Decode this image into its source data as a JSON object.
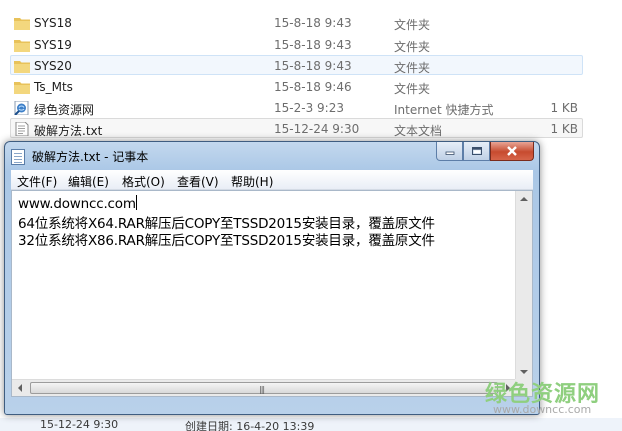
{
  "explorer": {
    "files": [
      {
        "name": "SYS18",
        "date": "15-8-18 9:43",
        "type": "文件夹",
        "size": "",
        "icon": "folder-icon",
        "state": ""
      },
      {
        "name": "SYS19",
        "date": "15-8-18 9:43",
        "type": "文件夹",
        "size": "",
        "icon": "folder-icon",
        "state": ""
      },
      {
        "name": "SYS20",
        "date": "15-8-18 9:43",
        "type": "文件夹",
        "size": "",
        "icon": "folder-icon",
        "state": "selected"
      },
      {
        "name": "Ts_Mts",
        "date": "15-8-18 9:46",
        "type": "文件夹",
        "size": "",
        "icon": "folder-icon",
        "state": ""
      },
      {
        "name": "绿色资源网",
        "date": "15-2-3 9:23",
        "type": "Internet 快捷方式",
        "size": "1 KB",
        "icon": "internet-shortcut-icon",
        "state": ""
      },
      {
        "name": "破解方法.txt",
        "date": "15-12-24 9:30",
        "type": "文本文档",
        "size": "1 KB",
        "icon": "text-file-icon",
        "state": "hover"
      }
    ],
    "status_left": "15-12-24 9:30",
    "status_mid": "创建日期: 16-4-20 13:39"
  },
  "notepad": {
    "title": "破解方法.txt - 记事本",
    "menu": [
      "文件(F)",
      "编辑(E)",
      "格式(O)",
      "查看(V)",
      "帮助(H)"
    ],
    "lines": [
      "www.downcc.com",
      "64位系统将X64.RAR解压后COPY至TSSD2015安装目录，覆盖原文件",
      "32位系统将X86.RAR解压后COPY至TSSD2015安装目录，覆盖原文件"
    ]
  },
  "watermark": {
    "logo": "绿色资源网",
    "url": "www.downcc.com"
  },
  "colors": {
    "folder": "#e8c25a",
    "selection_bg": "#f2f7fd",
    "close_button": "#c74b2f",
    "watermark": "#8fcf7f"
  }
}
